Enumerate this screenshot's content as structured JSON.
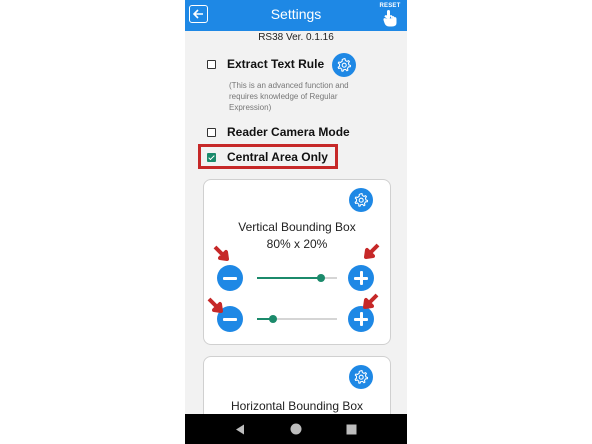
{
  "header": {
    "title": "Settings",
    "back_icon": "back-arrow-icon",
    "reset_label": "RESET",
    "reset_icon": "hand-tap-icon"
  },
  "version": "RS38 Ver. 0.1.16",
  "options": {
    "extract_text_rule": {
      "label": "Extract Text Rule",
      "checked": false,
      "note": "(This is an advanced function and requires knowledge of Regular Expression)"
    },
    "reader_camera_mode": {
      "label": "Reader Camera Mode",
      "checked": false
    },
    "central_area_only": {
      "label": "Central Area Only",
      "checked": true
    }
  },
  "vertical_box": {
    "title": "Vertical Bounding Box",
    "value": "80% x 20%",
    "slider1_level": 0.8,
    "slider2_level": 0.2
  },
  "horizontal_box": {
    "title": "Horizontal Bounding Box"
  },
  "colors": {
    "accent_blue": "#1e88e5",
    "checkbox_green": "#1b8a6b",
    "annotation_red": "#c62828"
  }
}
